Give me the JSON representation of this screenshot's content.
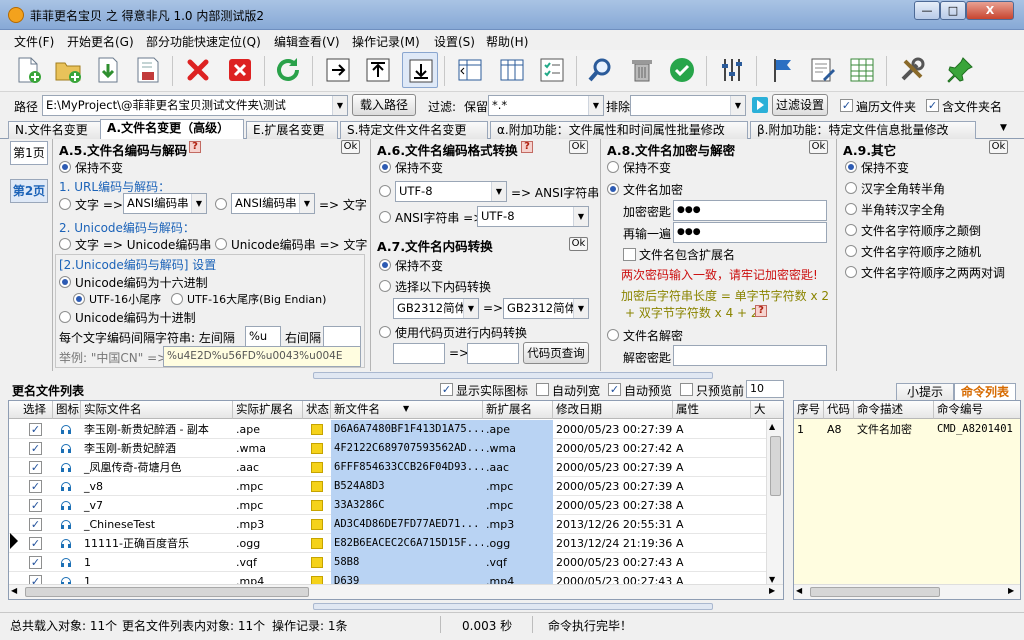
{
  "window": {
    "title": "菲菲更名宝贝 之 得意非凡 1.0 内部测试版2",
    "min": "—",
    "max": "□",
    "close": "X"
  },
  "menu": [
    "文件(F)",
    "开始更名(G)",
    "部分功能快速定位(Q)",
    "编辑查看(V)",
    "操作记录(M)",
    "设置(S)",
    "帮助(H)"
  ],
  "toolbar_icons": [
    "new-file-icon",
    "open-folder-icon",
    "import-icon",
    "save-icon",
    "delete-icon",
    "clear-icon",
    "refresh-icon",
    "move-right-icon",
    "move-up-icon",
    "move-down-icon",
    "columns-left-icon",
    "columns-icon",
    "checklist-icon",
    "search-icon",
    "trash-icon",
    "confirm-icon",
    "settings-sliders-icon",
    "flag-icon",
    "edit-doc-icon",
    "table-icon",
    "tools-icon",
    "pin-icon"
  ],
  "colors": {
    "accent": "#2d5bb3",
    "highlight": "#b9d3f3",
    "title_blue": "#1c63b8",
    "red": "#cc1010"
  },
  "path": {
    "label": "路径",
    "value": "E:\\MyProject\\@菲菲更名宝贝测试文件夹\\测试",
    "load_button": "载入路径",
    "filter_label": "过滤:",
    "keep_label": "保留",
    "keep_value": "*.*",
    "exclude_label": "排除",
    "exclude_value": "",
    "filter_settings": "过滤设置",
    "traverse": "遍历文件夹",
    "include_folder": "含文件夹名"
  },
  "tabs": [
    "N.文件名变更",
    "A.文件名变更（高级）",
    "E.扩展名变更",
    "S.特定文件文件名变更",
    "α.附加功能：文件属性和时间属性批量修改",
    "β.附加功能：特定文件信息批量修改"
  ],
  "pages": {
    "p1": "第1页",
    "p2": "第2页"
  },
  "a5": {
    "title": "A.5.文件名编码与解码",
    "help": "?",
    "ok": "Ok",
    "keep": "保持不变",
    "url_head": "1. URL编码与解码：",
    "url_text": "文字 =>",
    "url_combo1": "ANSI编码串",
    "url_combo2": "ANSI编码串",
    "url_to_text": "=> 文字",
    "uni_head": "2. Unicode编码与解码：",
    "uni_text": "文字 => Unicode编码串",
    "uni_back": "Unicode编码串 => 文字",
    "uni_setting": "[2.Unicode编码与解码] 设置",
    "hex": "Unicode编码为十六进制",
    "le": "UTF-16小尾序",
    "be": "UTF-16大尾序(Big Endian)",
    "dec": "Unicode编码为十进制",
    "sep_label": "每个文字编码间隔字符串: 左间隔",
    "left_sep": "%u",
    "right_label": "右间隔",
    "right_sep": "",
    "example_label": "举例: \"中国CN\" =>",
    "example_value": "%u4E2D%u56FD%u0043%u004E"
  },
  "a6": {
    "title": "A.6.文件名编码格式转换",
    "help": "?",
    "ok": "Ok",
    "keep": "保持不变",
    "from": "UTF-8",
    "to_ansi": "=> ANSI字符串",
    "ansi_label": "ANSI字符串 =>",
    "to": "UTF-8"
  },
  "a7": {
    "title": "A.7.文件名内码转换",
    "ok": "Ok",
    "keep": "保持不变",
    "select": "选择以下内码转换",
    "from": "GB2312简体",
    "arrow": "=>",
    "to": "GB2312简体",
    "codepage": "使用代码页进行内码转换",
    "cp_arrow": "=>",
    "query": "代码页查询"
  },
  "a8": {
    "title": "A.8.文件名加密与解密",
    "ok": "Ok",
    "keep": "保持不变",
    "encrypt": "文件名加密",
    "key_label": "加密密匙",
    "key": "●●●",
    "again_label": "再输一遍",
    "again": "●●●",
    "include_ext": "文件名包含扩展名",
    "warn": "两次密码输入一致，请牢记加密密匙!",
    "len_formula1": "加密后字符串长度 = 单字节字符数 x 2",
    "len_formula2": "+ 双字节字符数 x 4 + 2",
    "help": "?",
    "decrypt": "文件名解密",
    "dkey_label": "解密密匙"
  },
  "a9": {
    "title": "A.9.其它",
    "ok": "Ok",
    "options": [
      "保持不变",
      "汉字全角转半角",
      "半角转汉字全角",
      "文件名字符顺序之颠倒",
      "文件名字符顺序之随机",
      "文件名字符顺序之两两对调"
    ]
  },
  "list": {
    "title": "更名文件列表",
    "show_icon": "显示实际图标",
    "auto_width": "自动列宽",
    "auto_preview": "自动预览",
    "only_preview": "只预览前",
    "only_count": "10",
    "columns": [
      "选择",
      "图标",
      "实际文件名",
      "实际扩展名",
      "状态",
      "新文件名",
      "新扩展名",
      "修改日期",
      "属性",
      "大"
    ],
    "rows": [
      {
        "name": "李玉刚-新贵妃醉酒 - 副本",
        "ext": ".ape",
        "new": "D6A6A7480BF1F413D1A75...",
        "newext": ".ape",
        "date": "2000/05/23 00:27:39",
        "attr": "A"
      },
      {
        "name": "李玉刚-新贵妃醉酒",
        "ext": ".wma",
        "new": "4F2122C689707593562AD...",
        "newext": ".wma",
        "date": "2000/05/23 00:27:42",
        "attr": "A"
      },
      {
        "name": "_凤凰传奇-荷塘月色",
        "ext": ".aac",
        "new": "6FFF854633CCB26F04D93...",
        "newext": ".aac",
        "date": "2000/05/23 00:27:39",
        "attr": "A"
      },
      {
        "name": "_v8",
        "ext": ".mpc",
        "new": "B524A8D3",
        "newext": ".mpc",
        "date": "2000/05/23 00:27:39",
        "attr": "A"
      },
      {
        "name": "_v7",
        "ext": ".mpc",
        "new": "33A3286C",
        "newext": ".mpc",
        "date": "2000/05/23 00:27:38",
        "attr": "A"
      },
      {
        "name": "_ChineseTest",
        "ext": ".mp3",
        "new": "AD3C4D86DE7FD77AED71...",
        "newext": ".mp3",
        "date": "2013/12/26 20:55:31",
        "attr": "A"
      },
      {
        "name": "11111-正确百度音乐",
        "ext": ".ogg",
        "new": "E82B6EACEC2C6A715D15F...",
        "newext": ".ogg",
        "date": "2013/12/24 21:19:36",
        "attr": "A"
      },
      {
        "name": "1",
        "ext": ".vqf",
        "new": "58B8",
        "newext": ".vqf",
        "date": "2000/05/23 00:27:43",
        "attr": "A"
      },
      {
        "name": "1",
        "ext": ".mp4",
        "new": "D639",
        "newext": ".mp4",
        "date": "2000/05/23 00:27:43",
        "attr": "A"
      }
    ]
  },
  "right": {
    "tab_tip": "小提示",
    "tab_cmd": "命令列表",
    "columns": [
      "序号",
      "代码",
      "命令描述",
      "命令编号"
    ],
    "rows": [
      {
        "no": "1",
        "code": "A8",
        "desc": "文件名加密",
        "id": "CMD_A8201401"
      }
    ]
  },
  "status": {
    "loaded": "总共载入对象: 11个",
    "in_list": "更名文件列表内对象: 11个",
    "ops": "操作记录: 1条",
    "time": "0.003 秒",
    "msg": "命令执行完毕！"
  }
}
